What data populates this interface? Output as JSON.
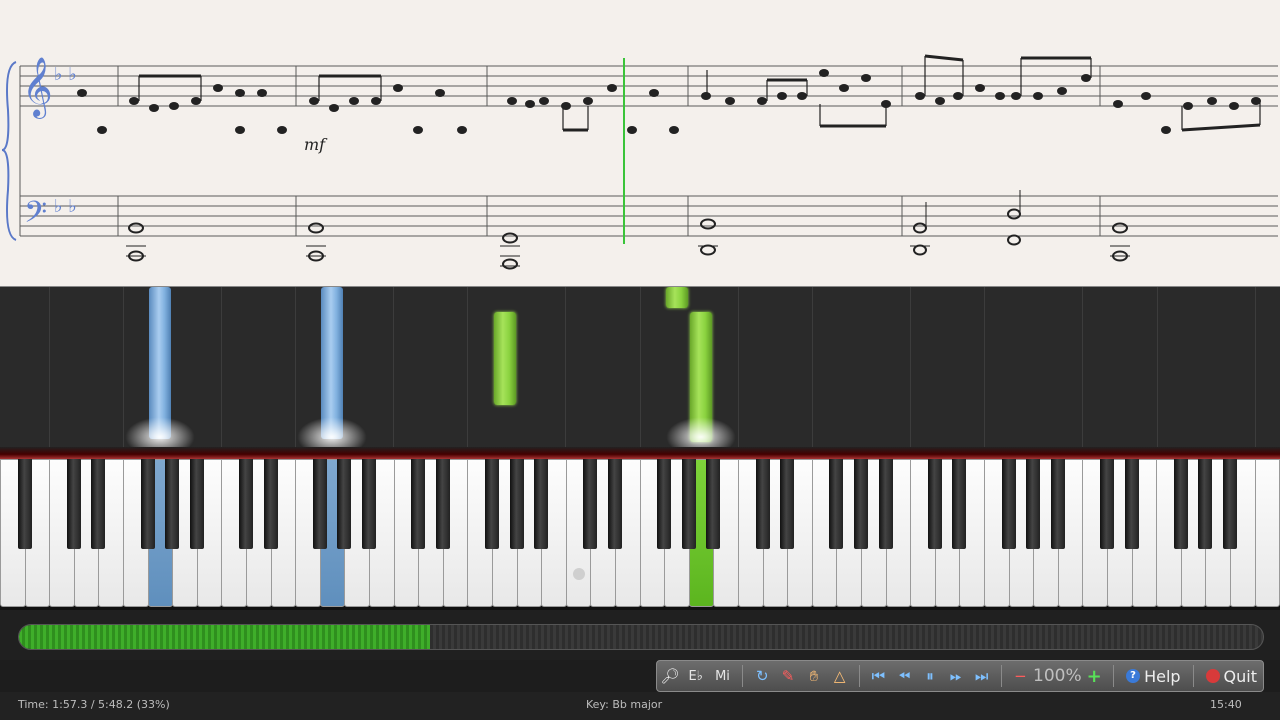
{
  "sheet": {
    "dynamic_marking": "mf",
    "treble_clef_glyph": "𝄞",
    "bass_clef_glyph": "𝄢",
    "key_signature": "♭ ♭"
  },
  "toolbar": {
    "eb_label": "E♭",
    "mi_label": "Mi",
    "zoom": "100%",
    "help_label": "Help",
    "quit_label": "Quit",
    "icons": [
      "search-icon",
      "undo-icon",
      "pencil-icon",
      "hand-icon",
      "metronome-icon",
      "skip-start-icon",
      "rewind-icon",
      "pause-icon",
      "fast-forward-icon",
      "skip-end-icon",
      "zoom-out-icon",
      "zoom-in-icon",
      "help-icon",
      "quit-icon"
    ]
  },
  "progress": {
    "fraction": 0.33
  },
  "status": {
    "time": "Time:  1:57.3 / 5:48.2 (33%)",
    "key": "Key: Bb major",
    "clock": "15:40"
  },
  "colors": {
    "right_hand": "#8ad23f",
    "left_hand": "#82b2e0",
    "playhead": "#3ac43a",
    "progress": "#3fae2a"
  }
}
